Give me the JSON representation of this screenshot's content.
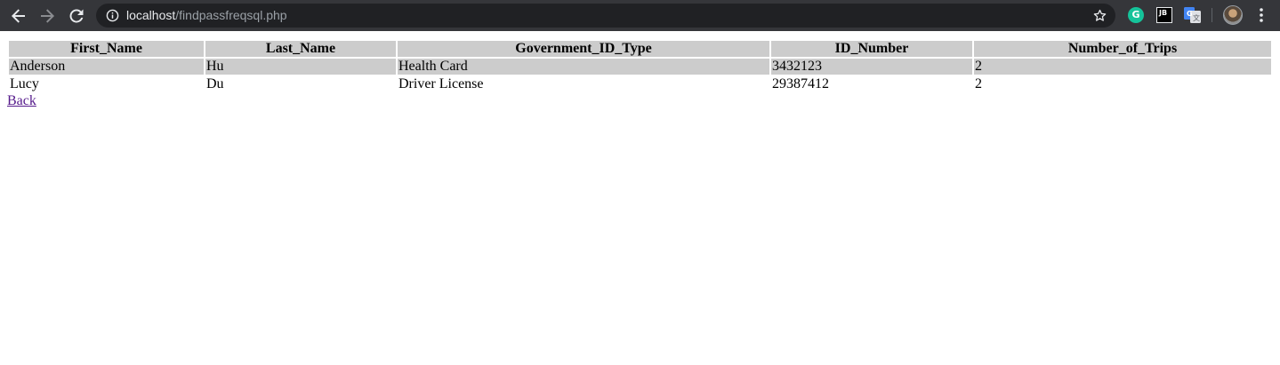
{
  "browser": {
    "url_host": "localhost",
    "url_path": "/findpassfreqsql.php",
    "extensions": {
      "grammarly_letter": "G",
      "jetbrains_label": "JB"
    },
    "icons": [
      "back-arrow-icon",
      "forward-arrow-icon",
      "reload-icon",
      "info-icon",
      "bookmark-star-icon",
      "grammarly-icon",
      "jetbrains-icon",
      "google-translate-icon",
      "profile-avatar",
      "kebab-menu-icon"
    ],
    "toolbar_color": "#35363a",
    "omnibox_color": "#202124"
  },
  "table": {
    "headers": [
      "First_Name",
      "Last_Name",
      "Government_ID_Type",
      "ID_Number",
      "Number_of_Trips"
    ],
    "header_bg": "#cccccc",
    "rows": [
      [
        "Anderson",
        "Hu",
        "Health Card",
        "3432123",
        "2"
      ],
      [
        "Lucy",
        "Du",
        "Driver License",
        "29387412",
        "2"
      ]
    ]
  },
  "back_link": {
    "label": "Back",
    "color": "#551a8b"
  }
}
